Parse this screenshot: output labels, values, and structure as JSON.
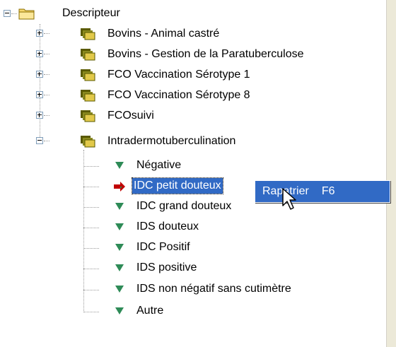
{
  "tree": {
    "root": {
      "label": "Descripteur",
      "expanded": true
    },
    "groups": [
      {
        "label": "Bovins - Animal castré",
        "expanded": false
      },
      {
        "label": "Bovins - Gestion de la Paratuberculose",
        "expanded": false
      },
      {
        "label": "FCO Vaccination Sérotype 1",
        "expanded": false
      },
      {
        "label": "FCO Vaccination Sérotype 8",
        "expanded": false
      },
      {
        "label": "FCOsuivi",
        "expanded": false
      },
      {
        "label": "Intradermotuberculination",
        "expanded": true
      }
    ],
    "children": [
      {
        "label": "Négative",
        "icon": "green-triangle-icon",
        "selected": false
      },
      {
        "label": "IDC petit douteux",
        "icon": "red-green-arrow-icon",
        "selected": true
      },
      {
        "label": "IDC grand douteux",
        "icon": "green-triangle-icon",
        "selected": false
      },
      {
        "label": "IDS douteux",
        "icon": "green-triangle-icon",
        "selected": false
      },
      {
        "label": "IDC Positif",
        "icon": "green-triangle-icon",
        "selected": false
      },
      {
        "label": "IDS positive",
        "icon": "green-triangle-icon",
        "selected": false
      },
      {
        "label": "IDS non négatif sans cutimètre",
        "icon": "green-triangle-icon",
        "selected": false
      },
      {
        "label": "Autre",
        "icon": "green-triangle-icon",
        "selected": false
      }
    ]
  },
  "context_menu": {
    "item_label": "Rapatrier",
    "shortcut": "F6"
  },
  "colors": {
    "selection": "#316ac5",
    "folder_root": "#f5d76e",
    "folder_group_dark": "#5a5a00",
    "folder_group_light": "#e2c94a",
    "triangle_green": "#2e8b57"
  }
}
